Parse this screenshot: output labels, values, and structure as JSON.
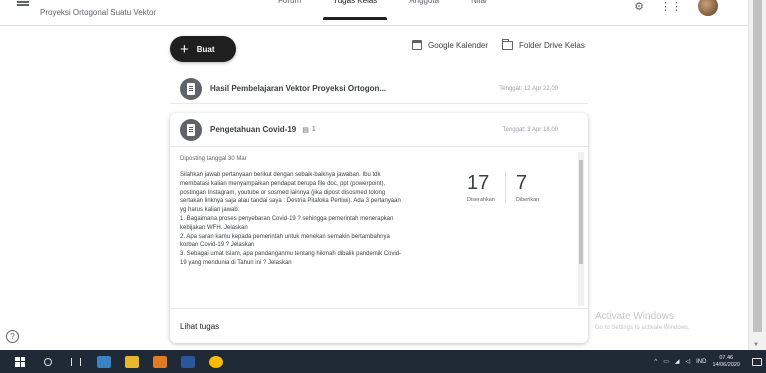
{
  "header": {
    "class_name": "Proyeksi Ortogonal Suatu Vektor",
    "tabs": [
      {
        "label": "Forum"
      },
      {
        "label": "Tugas Kelas",
        "active": true
      },
      {
        "label": "Anggota"
      },
      {
        "label": "Nilai"
      }
    ]
  },
  "toolbar": {
    "create_label": "Buat",
    "calendar_label": "Google Kalender",
    "folder_label": "Folder Drive Kelas"
  },
  "items": [
    {
      "title": "Hasil Pembelajaran Vektor Proyeksi Ortogon...",
      "due": "Tenggat: 12 Apr 22.00"
    }
  ],
  "expanded": {
    "title": "Pengetahuan Covid-19",
    "comment_count": "1",
    "due": "Tenggat: 3 Apr 18.00",
    "posted": "Diposting tanggal 30 Mar",
    "description_lines": [
      "Silahkan jawab pertanyaan berikut dengan sebaik-baiknya jawaban. Ibu tdk",
      "membatasi kalian menyampaikan pendapat berupa file doc, ppt (powerpoint),",
      "postingan Instagram, youtube or sosmed  lainnya (jika dipost disosmed tolong",
      "sertakan linknya saja atau tandai saya : Destria Pitaloka Pertiwi). Ada 3 pertanyaan",
      "yg harus kalian jawab:",
      "1. Bagaimana proses penyebaran Covid-19 ? sehingga pemerintah menerapkan",
      "kebijakan WFH. Jelaskan",
      "2. Apa saran kamu kepada pemerintah untuk menekan semakin bertambahnya",
      "korban Covid-19 ? Jelaskan",
      "3. Sebagai umat Islam, apa pandanganmu tentang hikmah dibalik pandemik Covid-",
      "19 yang mendunia di Tahun ini ? Jelaskan"
    ],
    "turned_in": {
      "value": "17",
      "label": "Diserahkan"
    },
    "assigned": {
      "value": "7",
      "label": "Diberikan"
    },
    "view_label": "Lihat tugas"
  },
  "watermark": {
    "line1": "Activate Windows",
    "line2": "Go to Settings to activate Windows."
  },
  "taskbar": {
    "lang": "IND",
    "time": "07.46",
    "date": "14/06/2020"
  },
  "colors": {
    "word_blue": "#2b579a",
    "chrome_yellow": "#fbbc05",
    "taskbar_bg": "#1f2a36"
  }
}
